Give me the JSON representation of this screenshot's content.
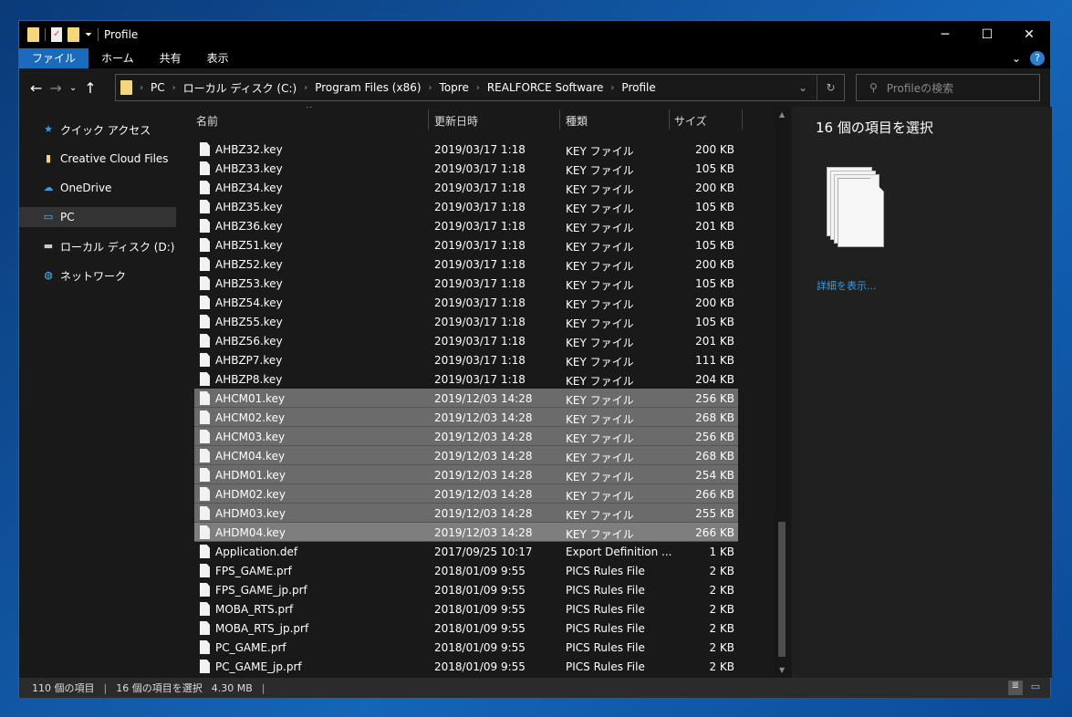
{
  "window": {
    "title": "Profile",
    "minimize": "─",
    "maximize": "☐",
    "close": "✕"
  },
  "ribbon": {
    "tabs": [
      "ファイル",
      "ホーム",
      "共有",
      "表示"
    ],
    "expand": "⌄",
    "help": "?"
  },
  "address": {
    "crumbs": [
      "PC",
      "ローカル ディスク (C:)",
      "Program Files (x86)",
      "Topre",
      "REALFORCE Software",
      "Profile"
    ],
    "search_placeholder": "Profileの検索"
  },
  "nav": [
    {
      "label": "クイック アクセス",
      "icon": "star-icon"
    },
    {
      "label": "Creative Cloud Files",
      "icon": "creative-cloud-folder-icon"
    },
    {
      "label": "OneDrive",
      "icon": "cloud-icon"
    },
    {
      "label": "PC",
      "icon": "monitor-icon",
      "selected": true
    },
    {
      "label": "ローカル ディスク (D:)",
      "icon": "drive-icon"
    },
    {
      "label": "ネットワーク",
      "icon": "network-icon"
    }
  ],
  "columns": [
    "名前",
    "更新日時",
    "種類",
    "サイズ"
  ],
  "files": [
    [
      "AHBZ32.key",
      "2019/03/17 1:18",
      "KEY ファイル",
      "200 KB"
    ],
    [
      "AHBZ33.key",
      "2019/03/17 1:18",
      "KEY ファイル",
      "105 KB"
    ],
    [
      "AHBZ34.key",
      "2019/03/17 1:18",
      "KEY ファイル",
      "200 KB"
    ],
    [
      "AHBZ35.key",
      "2019/03/17 1:18",
      "KEY ファイル",
      "105 KB"
    ],
    [
      "AHBZ36.key",
      "2019/03/17 1:18",
      "KEY ファイル",
      "201 KB"
    ],
    [
      "AHBZ51.key",
      "2019/03/17 1:18",
      "KEY ファイル",
      "105 KB"
    ],
    [
      "AHBZ52.key",
      "2019/03/17 1:18",
      "KEY ファイル",
      "200 KB"
    ],
    [
      "AHBZ53.key",
      "2019/03/17 1:18",
      "KEY ファイル",
      "105 KB"
    ],
    [
      "AHBZ54.key",
      "2019/03/17 1:18",
      "KEY ファイル",
      "200 KB"
    ],
    [
      "AHBZ55.key",
      "2019/03/17 1:18",
      "KEY ファイル",
      "105 KB"
    ],
    [
      "AHBZ56.key",
      "2019/03/17 1:18",
      "KEY ファイル",
      "201 KB"
    ],
    [
      "AHBZP7.key",
      "2019/03/17 1:18",
      "KEY ファイル",
      "111 KB"
    ],
    [
      "AHBZP8.key",
      "2019/03/17 1:18",
      "KEY ファイル",
      "204 KB"
    ],
    [
      "AHCM01.key",
      "2019/12/03 14:28",
      "KEY ファイル",
      "256 KB"
    ],
    [
      "AHCM02.key",
      "2019/12/03 14:28",
      "KEY ファイル",
      "268 KB"
    ],
    [
      "AHCM03.key",
      "2019/12/03 14:28",
      "KEY ファイル",
      "256 KB"
    ],
    [
      "AHCM04.key",
      "2019/12/03 14:28",
      "KEY ファイル",
      "268 KB"
    ],
    [
      "AHDM01.key",
      "2019/12/03 14:28",
      "KEY ファイル",
      "254 KB"
    ],
    [
      "AHDM02.key",
      "2019/12/03 14:28",
      "KEY ファイル",
      "266 KB"
    ],
    [
      "AHDM03.key",
      "2019/12/03 14:28",
      "KEY ファイル",
      "255 KB"
    ],
    [
      "AHDM04.key",
      "2019/12/03 14:28",
      "KEY ファイル",
      "266 KB"
    ],
    [
      "Application.def",
      "2017/09/25 10:17",
      "Export Definition ...",
      "1 KB"
    ],
    [
      "FPS_GAME.prf",
      "2018/01/09 9:55",
      "PICS Rules File",
      "2 KB"
    ],
    [
      "FPS_GAME_jp.prf",
      "2018/01/09 9:55",
      "PICS Rules File",
      "2 KB"
    ],
    [
      "MOBA_RTS.prf",
      "2018/01/09 9:55",
      "PICS Rules File",
      "2 KB"
    ],
    [
      "MOBA_RTS_jp.prf",
      "2018/01/09 9:55",
      "PICS Rules File",
      "2 KB"
    ],
    [
      "PC_GAME.prf",
      "2018/01/09 9:55",
      "PICS Rules File",
      "2 KB"
    ],
    [
      "PC_GAME_jp.prf",
      "2018/01/09 9:55",
      "PICS Rules File",
      "2 KB"
    ]
  ],
  "selected_range": [
    13,
    20
  ],
  "focused_index": 20,
  "details": {
    "heading": "16 個の項目を選択",
    "link": "詳細を表示..."
  },
  "status": {
    "count": "110 個の項目",
    "selection": "16 個の項目を選択",
    "size": "4.30 MB"
  },
  "colors": {
    "accent": "#1a6bbd",
    "link": "#3a9be0",
    "selection": "#6b6b6b"
  }
}
